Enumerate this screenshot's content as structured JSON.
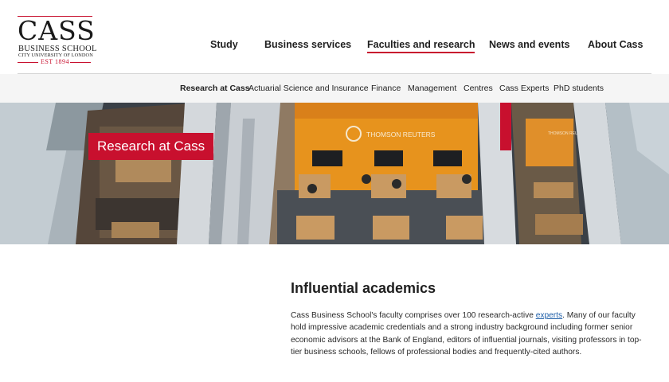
{
  "logo": {
    "wordmark": "CASS",
    "school": "BUSINESS SCHOOL",
    "university": "CITY UNIVERSITY OF LONDON",
    "est": "EST 1894",
    "accent_color": "#c8102e"
  },
  "main_nav": {
    "items": [
      {
        "label": "Study",
        "active": false
      },
      {
        "label": "Business services",
        "active": false
      },
      {
        "label": "Faculties and research",
        "active": true
      },
      {
        "label": "News and events",
        "active": false
      },
      {
        "label": "About Cass",
        "active": false
      }
    ]
  },
  "sub_nav": {
    "items": [
      {
        "label": "Research at Cass",
        "active": true
      },
      {
        "label": "Actuarial Science and Insurance",
        "active": false
      },
      {
        "label": "Finance",
        "active": false
      },
      {
        "label": "Management",
        "active": false
      },
      {
        "label": "Centres",
        "active": false
      },
      {
        "label": "Cass Experts",
        "active": false
      },
      {
        "label": "PhD students",
        "active": false
      }
    ]
  },
  "hero": {
    "badge": "Research at Cass",
    "wall_sign": "THOMSON REUTERS",
    "wall_sign_right": "THOMSON REUTERS"
  },
  "content": {
    "title": "Influential academics",
    "body_before_link": "Cass Business School's faculty comprises over 100 research-active ",
    "link": "experts",
    "body_after_link": ". Many of our faculty hold impressive academic credentials and a strong industry background including former senior economic advisors at the Bank of England, editors of influential journals, visiting professors in top-tier business schools, fellows of professional bodies and frequently-cited authors."
  }
}
